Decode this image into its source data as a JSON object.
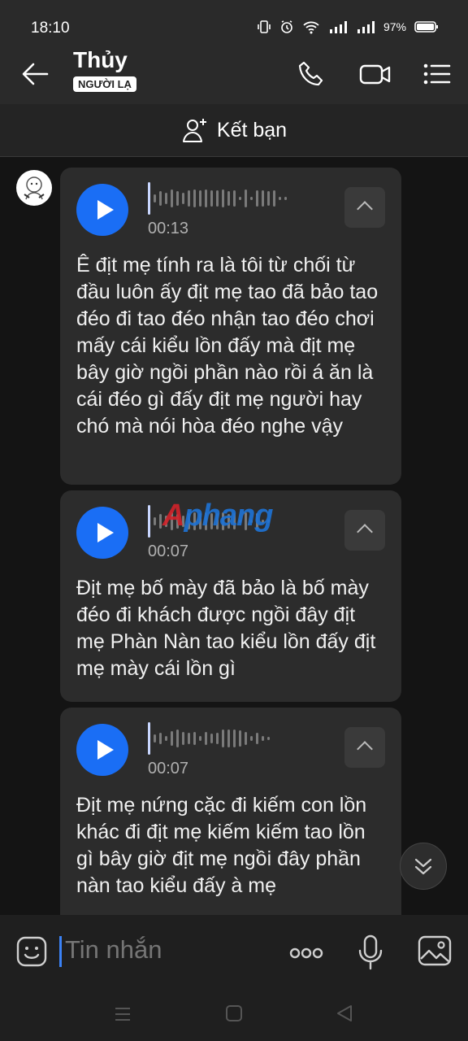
{
  "status": {
    "time": "18:10",
    "battery": "97%"
  },
  "header": {
    "name": "Thủy",
    "badge": "NGƯỜI LẠ"
  },
  "friend_bar": {
    "label": "Kết bạn"
  },
  "messages": [
    {
      "duration": "00:13",
      "text": "Ê địt mẹ tính ra là tôi từ chối từ đầu luôn ấy địt mẹ tao đã bảo tao đéo đi tao đéo nhận tao đéo chơi mấy cái kiểu lồn đấy mà địt mẹ bây giờ ngồi phần nào rồi á ăn là cái đéo gì đấy địt mẹ người hay chó mà nói hòa đéo nghe vậy"
    },
    {
      "duration": "00:07",
      "text": "Địt mẹ bố mày đã bảo là bố mày đéo đi khách được ngồi đây địt mẹ Phàn Nàn tao kiểu lồn đấy địt mẹ mày cái lồn gì"
    },
    {
      "duration": "00:07",
      "text": "Địt mẹ nứng cặc đi kiếm con lồn khác đi địt mẹ kiếm kiếm tao lồn gì bây giờ địt mẹ ngồi đây phần nàn tao kiểu đấy à mẹ"
    }
  ],
  "watermark": {
    "text": "Aphang",
    "first": "A",
    "rest": "phang"
  },
  "composer": {
    "placeholder": "Tin nhắn"
  },
  "colors": {
    "accent": "#1a6ef5",
    "background": "#141414",
    "bubble": "#2c2c2c"
  }
}
